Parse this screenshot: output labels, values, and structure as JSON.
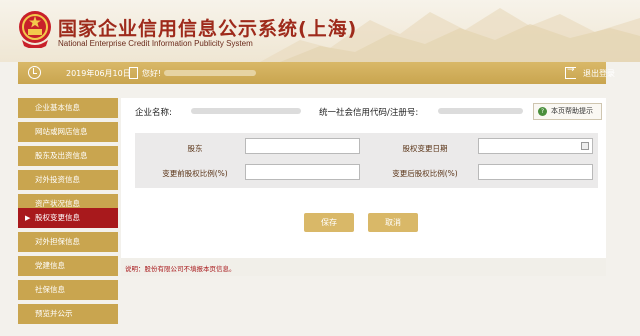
{
  "header": {
    "title_cn": "国家企业信用信息公示系统(上海)",
    "title_en": "National Enterprise Credit Information Publicity System"
  },
  "infobar": {
    "date": "2019年06月10日",
    "hello": "您好!",
    "logout": "退出登录"
  },
  "sidebar": {
    "items": [
      {
        "label": "企业基本信息"
      },
      {
        "label": "网站或网店信息"
      },
      {
        "label": "股东及出资信息"
      },
      {
        "label": "对外投资信息"
      },
      {
        "label": "资产状况信息"
      },
      {
        "label": "股权变更信息"
      },
      {
        "label": "对外担保信息"
      },
      {
        "label": "党建信息"
      },
      {
        "label": "社保信息"
      },
      {
        "label": "预览并公示"
      }
    ],
    "active_index": 5,
    "active_marker": "▶"
  },
  "main": {
    "company_label": "企业名称:",
    "credit_label": "统一社会信用代码/注册号:",
    "help_label": "本页帮助提示",
    "help_icon": "?",
    "form": {
      "shareholder_label": "股东",
      "shareholder_value": "",
      "change_date_label": "股权变更日期",
      "change_date_value": "",
      "before_ratio_label": "变更前股权比例(%)",
      "before_ratio_value": "",
      "after_ratio_label": "变更后股权比例(%)",
      "after_ratio_value": ""
    },
    "save_label": "保存",
    "cancel_label": "取消",
    "note": "说明：股份有限公司不填报本页信息。"
  },
  "colors": {
    "brand_red": "#a8191c",
    "gold": "#c9a54f",
    "button_gold": "#d9b868"
  }
}
